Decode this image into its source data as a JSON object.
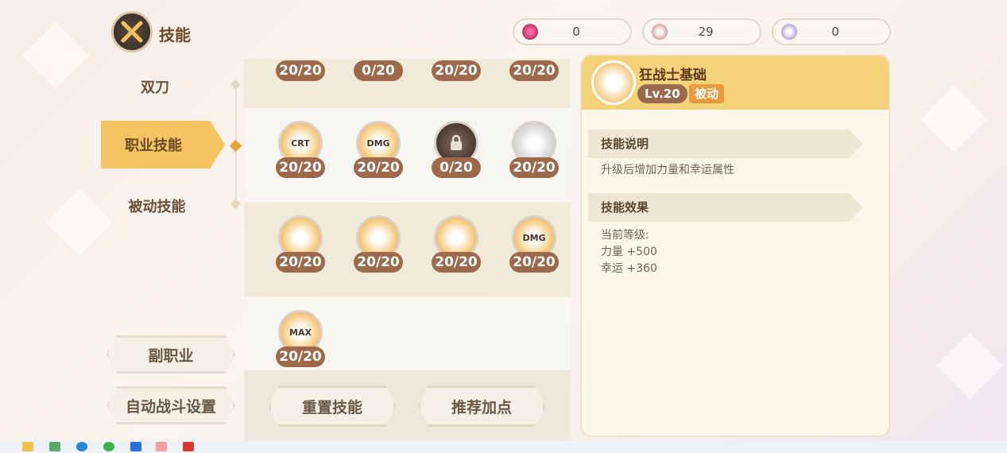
{
  "header": {
    "title": "技能",
    "icon": "crossed-swords-icon"
  },
  "currencies": [
    {
      "icon": "gem-icon",
      "value": "0",
      "color": "#c0306a"
    },
    {
      "icon": "scroll-icon",
      "value": "29",
      "color": "#d9a0a0"
    },
    {
      "icon": "book-icon",
      "value": "0",
      "color": "#b6a4d8"
    }
  ],
  "nav": {
    "items": [
      {
        "label": "双刀"
      },
      {
        "label": "职业技能"
      },
      {
        "label": "被动技能"
      }
    ]
  },
  "side_buttons": {
    "sub_job": "副职业",
    "auto_battle": "自动战斗设置"
  },
  "skills": {
    "rows": [
      [
        {
          "level": "20/20",
          "icon": "skill-icon"
        },
        {
          "level": "0/20",
          "icon": "skill-icon"
        },
        {
          "level": "20/20",
          "icon": "skill-icon"
        },
        {
          "level": "20/20",
          "icon": "skill-icon"
        }
      ],
      [
        {
          "level": "20/20",
          "icon": "crit-skill-icon",
          "tag": "CRT"
        },
        {
          "level": "20/20",
          "icon": "dmg-skill-icon",
          "tag": "DMG"
        },
        {
          "level": "0/20",
          "icon": "locked-skill-icon"
        },
        {
          "level": "20/20",
          "icon": "skill-icon"
        }
      ],
      [
        {
          "level": "20/20",
          "icon": "skill-icon"
        },
        {
          "level": "20/20",
          "icon": "skill-icon"
        },
        {
          "level": "20/20",
          "icon": "skill-icon"
        },
        {
          "level": "20/20",
          "icon": "dmg-skill-icon",
          "tag": "DMG"
        }
      ],
      [
        {
          "level": "20/20",
          "icon": "max-skill-icon",
          "tag": "MAX"
        }
      ]
    ]
  },
  "actions": {
    "reset": "重置技能",
    "recommend": "推荐加点"
  },
  "detail": {
    "name": "狂战士基础",
    "level": "Lv.20",
    "type": "被动",
    "desc_title": "技能说明",
    "desc_text": "升级后增加力量和幸运属性",
    "effect_title": "技能效果",
    "effect_lines": [
      "当前等级:",
      "力量 +500",
      "幸运 +360"
    ]
  }
}
